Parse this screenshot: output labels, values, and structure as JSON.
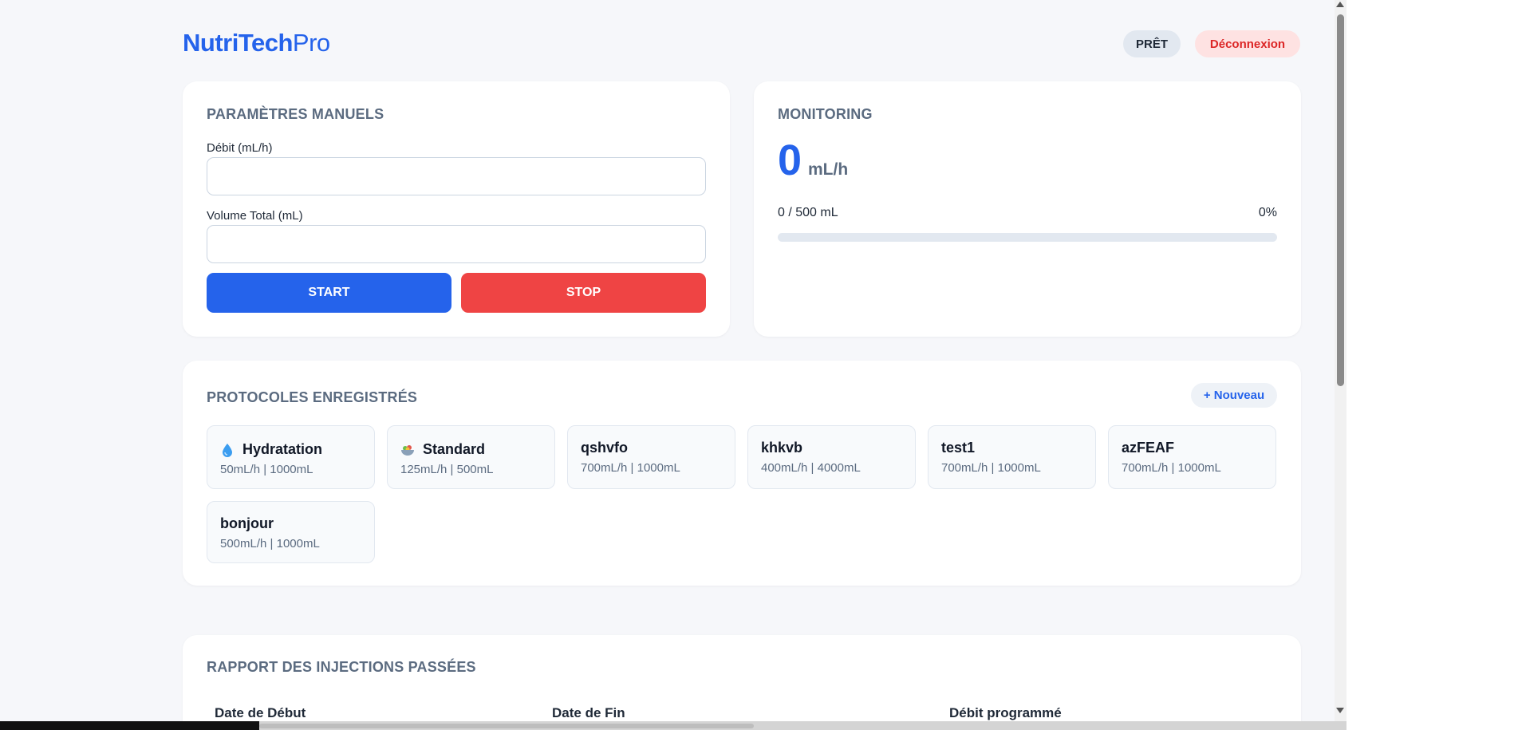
{
  "header": {
    "brand_bold": "NutriTech",
    "brand_light": "Pro",
    "status_label": "PRÊT",
    "logout_label": "Déconnexion"
  },
  "manual": {
    "title": "PARAMÈTRES MANUELS",
    "rate_label": "Débit (mL/h)",
    "rate_value": "",
    "volume_label": "Volume Total (mL)",
    "volume_value": "",
    "start_label": "START",
    "stop_label": "STOP"
  },
  "monitoring": {
    "title": "MONITORING",
    "rate_value": "0",
    "rate_unit": "mL/h",
    "volume_progress_text": "0 / 500 mL",
    "percent_text": "0%",
    "progress_fraction": 0
  },
  "protocols": {
    "title": "PROTOCOLES ENREGISTRÉS",
    "new_label": "+ Nouveau",
    "items": [
      {
        "icon": "water-drop-icon",
        "name": "Hydratation",
        "meta": "50mL/h | 1000mL"
      },
      {
        "icon": "salad-bowl-icon",
        "name": "Standard",
        "meta": "125mL/h | 500mL"
      },
      {
        "icon": "",
        "name": "qshvfo",
        "meta": "700mL/h | 1000mL"
      },
      {
        "icon": "",
        "name": "khkvb",
        "meta": "400mL/h | 4000mL"
      },
      {
        "icon": "",
        "name": "test1",
        "meta": "700mL/h | 1000mL"
      },
      {
        "icon": "",
        "name": "azFEAF",
        "meta": "700mL/h | 1000mL"
      },
      {
        "icon": "",
        "name": "bonjour",
        "meta": "500mL/h | 1000mL"
      }
    ]
  },
  "report": {
    "title": "RAPPORT DES INJECTIONS PASSÉES",
    "columns": [
      "Date de Début",
      "Date de Fin",
      "Débit programmé"
    ]
  },
  "colors": {
    "accent": "#2563eb",
    "danger": "#ef4444",
    "muted": "#5b6b80"
  }
}
